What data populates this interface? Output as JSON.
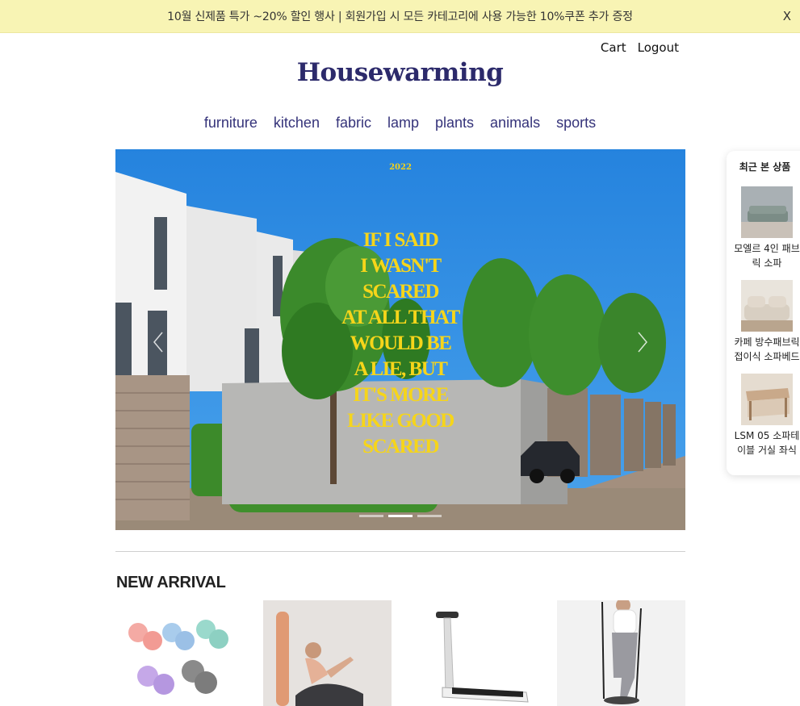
{
  "promo": {
    "text": "10월 신제품 특가 ~20% 할인 행사 | 회원가입 시 모든 카테고리에 사용 가능한 10%쿠폰 추가 증정",
    "close": "X"
  },
  "util_nav": {
    "cart": "Cart",
    "logout": "Logout"
  },
  "logo": "Housewarming",
  "nav": [
    "furniture",
    "kitchen",
    "fabric",
    "lamp",
    "plants",
    "animals",
    "sports"
  ],
  "hero": {
    "year": "2022",
    "quote_lines": [
      "IF I SAID",
      "I WASN'T",
      "SCARED",
      "AT ALL THAT",
      "WOULD BE",
      "A LIE, BUT",
      "IT'S MORE",
      "LIKE GOOD",
      "SCARED"
    ],
    "active_slide": 2,
    "slide_count": 3
  },
  "section": {
    "title": "NEW ARRIVAL"
  },
  "products": [
    {
      "icon": "dumbbells-image"
    },
    {
      "icon": "yoga-woman-image"
    },
    {
      "icon": "treadmill-image"
    },
    {
      "icon": "resistance-band-image"
    }
  ],
  "recent": {
    "title": "최근 본 상품",
    "items": [
      {
        "name": "모엘르 4인 패브릭 소파"
      },
      {
        "name": "카페 방수패브릭 접이식 소파베드"
      },
      {
        "name": "LSM 05 소파테이블 거실 좌식"
      }
    ]
  },
  "colors": {
    "promo_bg": "#f8f4b4",
    "logo": "#2c2a6b",
    "nav": "#35337a",
    "hero_text": "#f6d51a",
    "sky": "#2f8be0"
  }
}
